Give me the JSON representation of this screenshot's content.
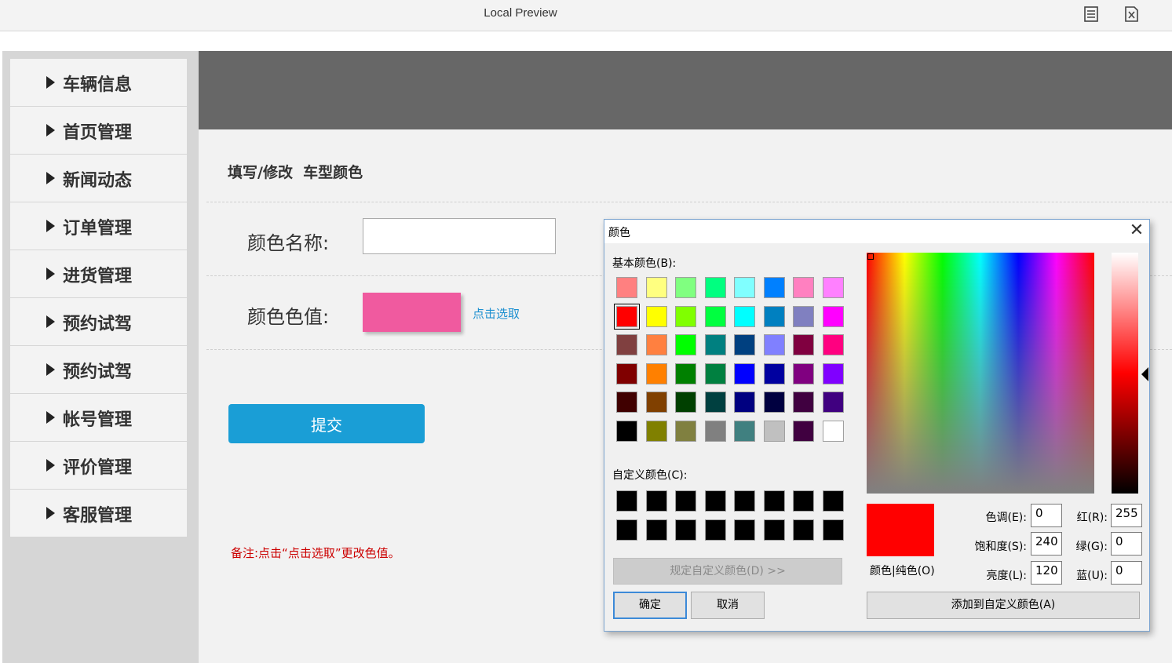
{
  "window": {
    "title": "Local Preview",
    "icons": [
      "document-icon",
      "close-document-icon"
    ]
  },
  "sidebar": {
    "items": [
      {
        "label": "车辆信息"
      },
      {
        "label": "首页管理"
      },
      {
        "label": "新闻动态"
      },
      {
        "label": "订单管理"
      },
      {
        "label": "进货管理"
      },
      {
        "label": "预约试驾"
      },
      {
        "label": "预约试驾"
      },
      {
        "label": "帐号管理"
      },
      {
        "label": "评价管理"
      },
      {
        "label": "客服管理"
      }
    ]
  },
  "form": {
    "title": "填写/修改  车型颜色",
    "name_label": "颜色名称:",
    "name_value": "",
    "value_label": "颜色色值:",
    "color_value": "#f05a9f",
    "pick_link": "点击选取",
    "submit_label": "提交",
    "remark": "备注:点击“点击选取”更改色值。"
  },
  "color_dialog": {
    "title": "颜色",
    "close_glyph": "✕",
    "basic_colors_label": "基本颜色(B):",
    "basic_colors": [
      [
        "#ff8080",
        "#ffff80",
        "#80ff80",
        "#00ff80",
        "#80ffff",
        "#0080ff",
        "#ff80c0",
        "#ff80ff"
      ],
      [
        "#ff0000",
        "#ffff00",
        "#80ff00",
        "#00ff40",
        "#00ffff",
        "#0080c0",
        "#8080c0",
        "#ff00ff"
      ],
      [
        "#804040",
        "#ff8040",
        "#00ff00",
        "#008080",
        "#004080",
        "#8080ff",
        "#800040",
        "#ff0080"
      ],
      [
        "#800000",
        "#ff8000",
        "#008000",
        "#008040",
        "#0000ff",
        "#0000a0",
        "#800080",
        "#8000ff"
      ],
      [
        "#400000",
        "#804000",
        "#004000",
        "#004040",
        "#000080",
        "#000040",
        "#400040",
        "#400080"
      ],
      [
        "#000000",
        "#808000",
        "#808040",
        "#808080",
        "#408080",
        "#c0c0c0",
        "#400040",
        "#ffffff"
      ]
    ],
    "selected_basic": [
      1,
      0
    ],
    "custom_colors_label": "自定义颜色(C):",
    "custom_colors": [
      [
        "#000000",
        "#000000",
        "#000000",
        "#000000",
        "#000000",
        "#000000",
        "#000000",
        "#000000"
      ],
      [
        "#000000",
        "#000000",
        "#000000",
        "#000000",
        "#000000",
        "#000000",
        "#000000",
        "#000000"
      ]
    ],
    "define_custom_label": "规定自定义颜色(D) >>",
    "ok_label": "确定",
    "cancel_label": "取消",
    "add_custom_label": "添加到自定义颜色(A)",
    "solid_label": "颜色|纯色(O)",
    "hue_label": "色调(E):",
    "hue": "0",
    "sat_label": "饱和度(S):",
    "sat": "240",
    "lum_label": "亮度(L):",
    "lum": "120",
    "red_label": "红(R):",
    "red": "255",
    "green_label": "绿(G):",
    "green": "0",
    "blue_label": "蓝(U):",
    "blue": "0",
    "current_color": "#ff0000"
  }
}
